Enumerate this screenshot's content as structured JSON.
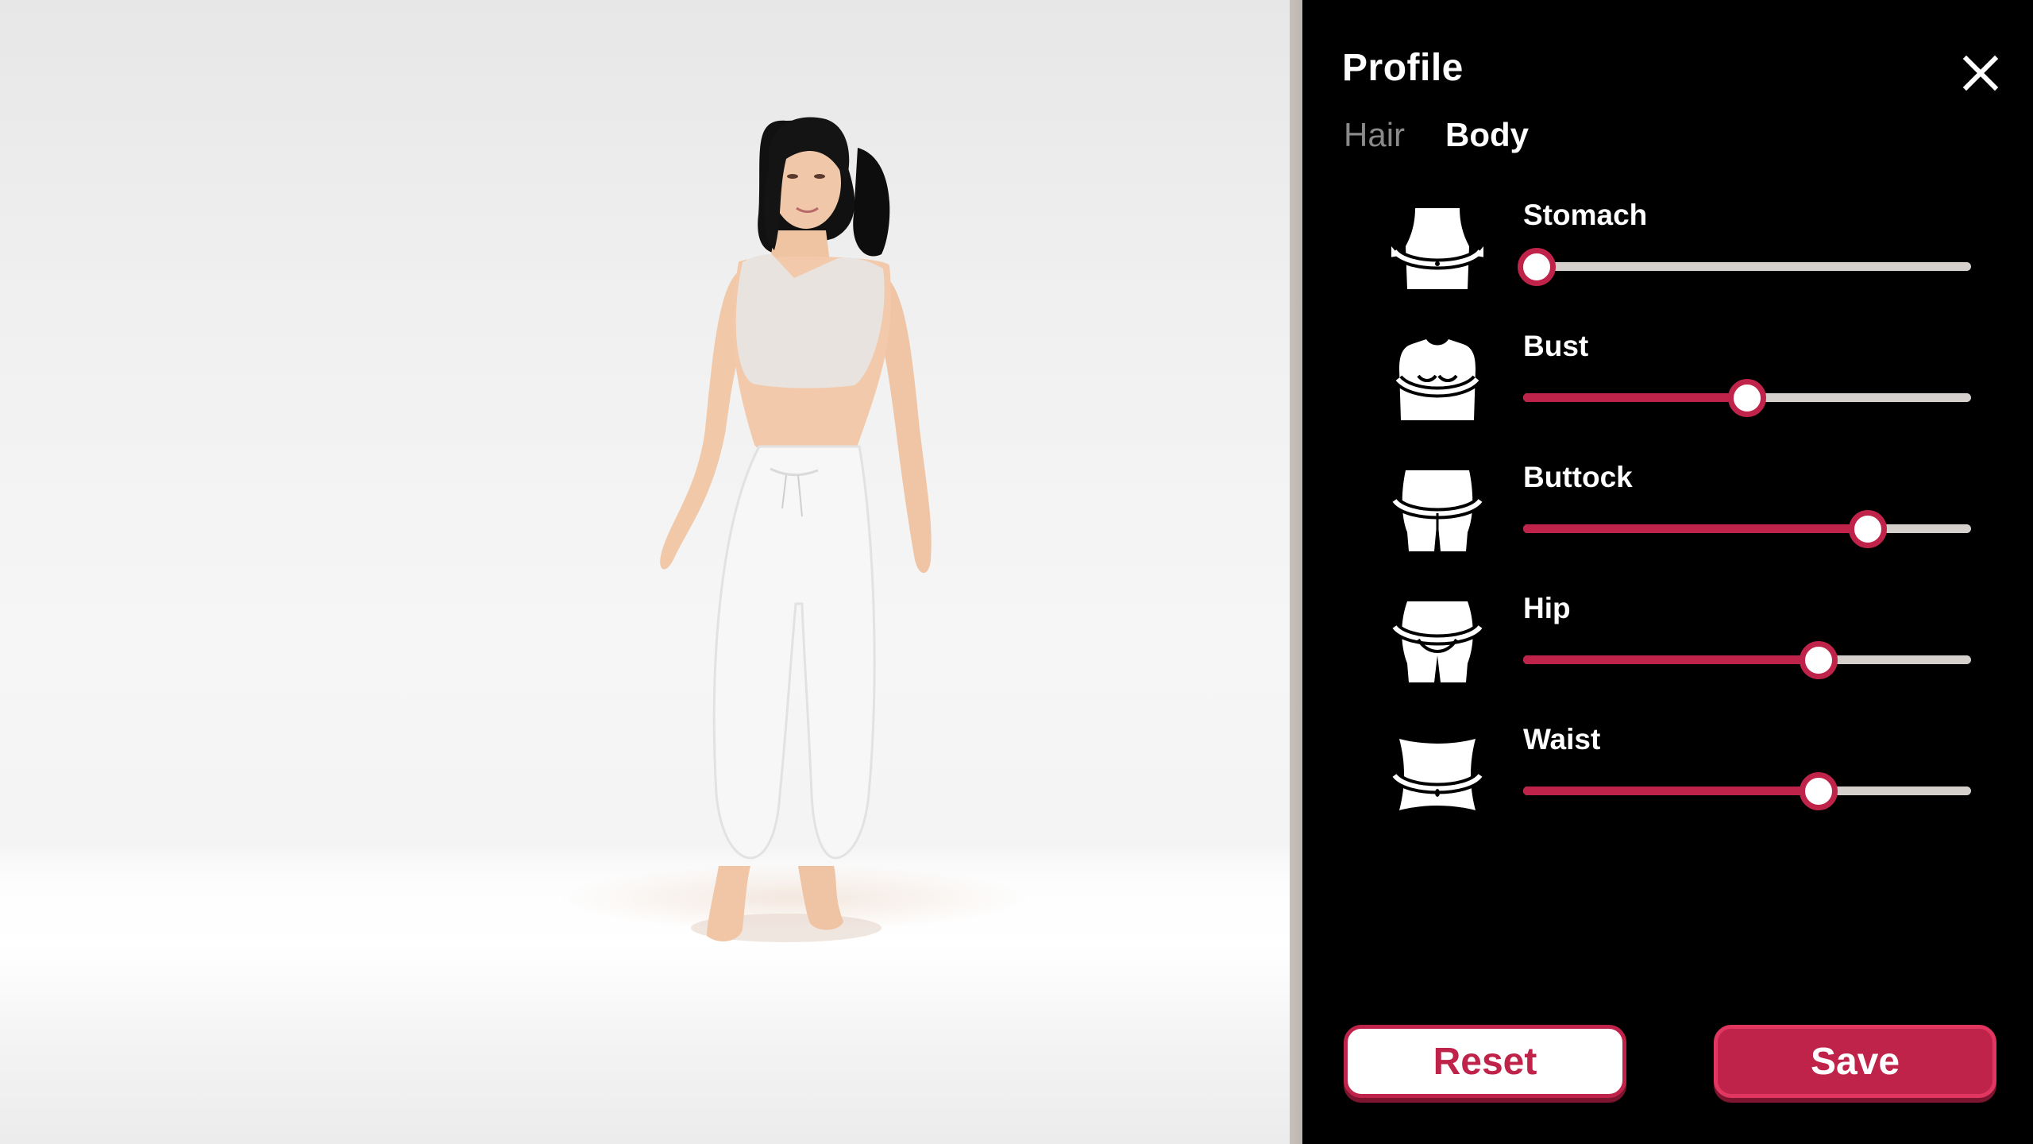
{
  "panel": {
    "title": "Profile",
    "tabs": [
      {
        "label": "Hair",
        "active": false
      },
      {
        "label": "Body",
        "active": true
      }
    ],
    "sliders": [
      {
        "label": "Stomach",
        "icon": "stomach-icon",
        "value": 0.03
      },
      {
        "label": "Bust",
        "icon": "bust-icon",
        "value": 0.5
      },
      {
        "label": "Buttock",
        "icon": "buttock-icon",
        "value": 0.77
      },
      {
        "label": "Hip",
        "icon": "hip-icon",
        "value": 0.66
      },
      {
        "label": "Waist",
        "icon": "waist-icon",
        "value": 0.66
      }
    ],
    "reset_label": "Reset",
    "save_label": "Save"
  },
  "colors": {
    "accent": "#c0234a",
    "track": "#d6d0cd",
    "panel_bg": "#000000",
    "viewport_bg": "#f2f2f2"
  }
}
